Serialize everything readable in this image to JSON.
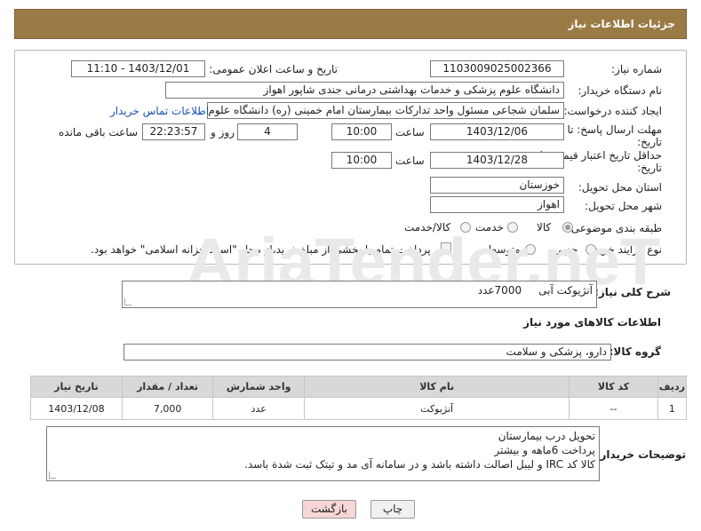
{
  "header": {
    "title": "جزئیات اطلاعات نیاز"
  },
  "form": {
    "need_number_label": "شماره نیاز:",
    "need_number": "1103009025002366",
    "announce_label": "تاریخ و ساعت اعلان عمومی:",
    "announce_value": "1403/12/01 - 11:10",
    "buyer_org_label": "نام دستگاه خریدار:",
    "buyer_org": "دانشگاه علوم پزشکی و خدمات بهداشتی درمانی جندی شاپور اهواز",
    "creator_label": "ایجاد کننده درخواست:",
    "creator": "سلمان شجاعی مسئول واحد تدارکات بیمارستان امام خمینی (ره) دانشگاه علوم پزشکی",
    "contact_link": "اطلاعات تماس خریدار",
    "deadline_label_1": "مهلت ارسال پاسخ: تا",
    "deadline_label_2": "تاریخ:",
    "deadline_date": "1403/12/06",
    "time_label": "ساعت",
    "deadline_time": "10:00",
    "days_value": "4",
    "days_label": "روز و",
    "remaining_time": "22:23:57",
    "remaining_label": "ساعت باقی مانده",
    "validity_label_1": "حداقل تاریخ اعتبار قیمت: تا",
    "validity_label_2": "تاریخ:",
    "validity_date": "1403/12/28",
    "validity_time": "10:00",
    "province_label": "استان محل تحویل:",
    "province": "خوزستان",
    "city_label": "شهر محل تحویل:",
    "city": "اهواز",
    "category_label": "طبقه بندی موضوعی:",
    "category_options": [
      "کالا",
      "خدمت",
      "کالا/خدمت"
    ],
    "purchase_type_label": "نوع فرآیند خرید :",
    "purchase_options": [
      "جزیی",
      "متوسط"
    ],
    "payment_note": "پرداخت تمام یا بخشی از مبلغ خرید،از محل \"اسناد خزانه اسلامی\" خواهد بود."
  },
  "summary": {
    "label": "شرح کلی نیاز:",
    "text": "آنژیوکت آبی     7000عدد"
  },
  "goods_info": {
    "title": "اطلاعات کالاهای مورد نیاز",
    "group_label": "گروه کالا:",
    "group_value": "دارو، پزشکی و سلامت"
  },
  "table": {
    "headers": [
      "ردیف",
      "کد کالا",
      "نام کالا",
      "واحد شمارش",
      "تعداد / مقدار",
      "تاریخ نیاز"
    ],
    "rows": [
      [
        "1",
        "--",
        "آنژیوکت",
        "عدد",
        "7,000",
        "1403/12/08"
      ]
    ]
  },
  "buyer_notes": {
    "label": "توضیحات خریدار:",
    "lines": [
      "تحویل درب بیمارستان",
      "پرداخت 6ماهه و بیشتر",
      "کالا کد IRC و لیبل اصالت داشته باشد و در سامانه آی مد و تیتک ثبت شدة باسد."
    ]
  },
  "buttons": {
    "print": "چاپ",
    "back": "بازگشت"
  },
  "watermark": {
    "text": "AriaTender.neT"
  },
  "colors": {
    "header_bg": "#9b7b45",
    "back_button_bg": "#f7d6d6",
    "table_header_bg": "#d8d8d8",
    "link": "#1a4fb5"
  }
}
